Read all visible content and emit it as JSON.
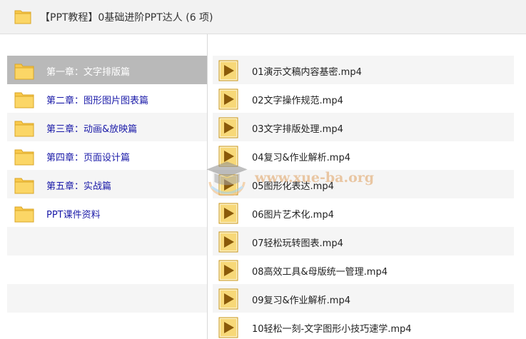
{
  "window": {
    "title": "【PPT教程】0基础进阶PPT达人 (6 项)"
  },
  "colors": {
    "folder": "#f9c94b",
    "folder_border": "#d9a526",
    "selected": "#b9b9b9",
    "link_blue": "#1a1aa8",
    "video_icon": "#c9961a"
  },
  "sidebar": {
    "items": [
      {
        "label": "第一章：文字排版篇",
        "icon": "folder-icon",
        "selected": true
      },
      {
        "label": "第二章：图形图片图表篇",
        "icon": "folder-icon"
      },
      {
        "label": "第三章：动画&放映篇",
        "icon": "folder-icon"
      },
      {
        "label": "第四章：页面设计篇",
        "icon": "folder-icon"
      },
      {
        "label": "第五章：实战篇",
        "icon": "folder-icon"
      },
      {
        "label": "PPT课件资料",
        "icon": "folder-icon"
      }
    ]
  },
  "files": {
    "items": [
      {
        "name": "01演示文稿内容基密.mp4",
        "icon": "video-file-icon"
      },
      {
        "name": "02文字操作规范.mp4",
        "icon": "video-file-icon"
      },
      {
        "name": "03文字排版处理.mp4",
        "icon": "video-file-icon"
      },
      {
        "name": "04复习&作业解析.mp4",
        "icon": "video-file-icon"
      },
      {
        "name": "05图形化表达.mp4",
        "icon": "video-file-icon"
      },
      {
        "name": "06图片艺术化.mp4",
        "icon": "video-file-icon"
      },
      {
        "name": "07轻松玩转图表.mp4",
        "icon": "video-file-icon"
      },
      {
        "name": "08高效工具&母版统一管理.mp4",
        "icon": "video-file-icon"
      },
      {
        "name": "09复习&作业解析.mp4",
        "icon": "video-file-icon"
      },
      {
        "name": "10轻松一刻-文字图形小技巧速学.mp4",
        "icon": "video-file-icon"
      }
    ]
  },
  "watermark": {
    "text": "www.xue-ba.org"
  }
}
